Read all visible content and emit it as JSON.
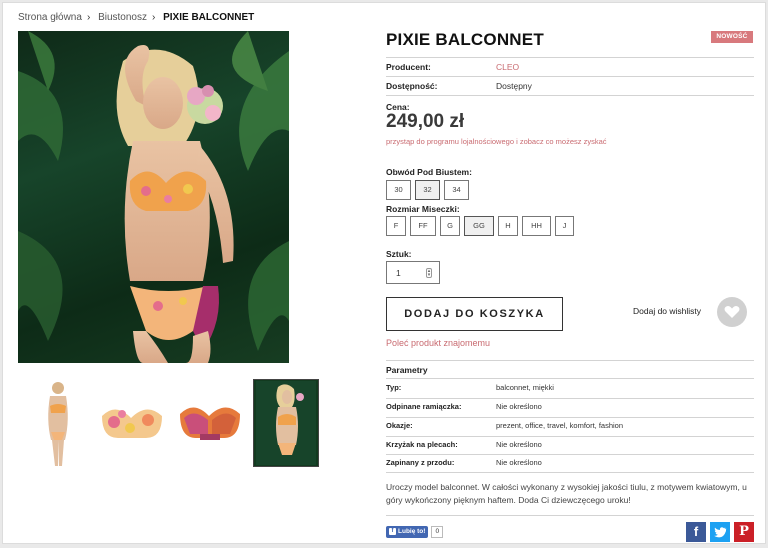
{
  "breadcrumb": {
    "items": [
      "Strona główna",
      "Biustonosz"
    ],
    "current": "PIXIE BALCONNET",
    "separator": "›"
  },
  "product": {
    "title": "PIXIE BALCONNET",
    "badge": "NOWOŚĆ",
    "producer_label": "Producent:",
    "producer_value": "CLEO",
    "availability_label": "Dostępność:",
    "availability_value": "Dostępny",
    "price_label": "Cena:",
    "price": "249,00 zł",
    "loyalty_text": "przystąp do programu lojalnościowego i zobacz co możesz zyskać"
  },
  "band": {
    "label": "Obwód Pod Biustem:",
    "options": [
      "30",
      "32",
      "34"
    ],
    "selected": "32"
  },
  "cup": {
    "label": "Rozmiar Miseczki:",
    "options": [
      "F",
      "FF",
      "G",
      "GG",
      "H",
      "HH",
      "J"
    ],
    "selected": "GG"
  },
  "quantity": {
    "label": "Sztuk:",
    "value": "1"
  },
  "actions": {
    "add_to_cart": "DODAJ DO KOSZYKA",
    "wishlist": "Dodaj do wishlisty",
    "recommend": "Poleć produkt znajomemu"
  },
  "params": {
    "title": "Parametry",
    "rows": [
      {
        "k": "Typ:",
        "v": "balconnet, miękki"
      },
      {
        "k": "Odpinane ramiączka:",
        "v": "Nie określono"
      },
      {
        "k": "Okazje:",
        "v": "prezent, office, travel, komfort, fashion"
      },
      {
        "k": "Krzyżak na plecach:",
        "v": "Nie określono"
      },
      {
        "k": "Zapinany z przodu:",
        "v": "Nie określono"
      }
    ]
  },
  "description": "Uroczy model balconnet. W całości wykonany z wysokiej jakości tiulu, z motywem kwiatowym, u góry wykończony pięknym haftem. Doda Ci dziewczęcego uroku!",
  "social": {
    "like_label": "Lubię to!",
    "like_count": "0",
    "icons": [
      "facebook-icon",
      "twitter-icon",
      "pinterest-icon"
    ]
  },
  "colors": {
    "accent": "#c96b71",
    "badge": "#d8797d",
    "facebook": "#3b5998",
    "twitter": "#1da1f2",
    "pinterest": "#cb2027"
  }
}
